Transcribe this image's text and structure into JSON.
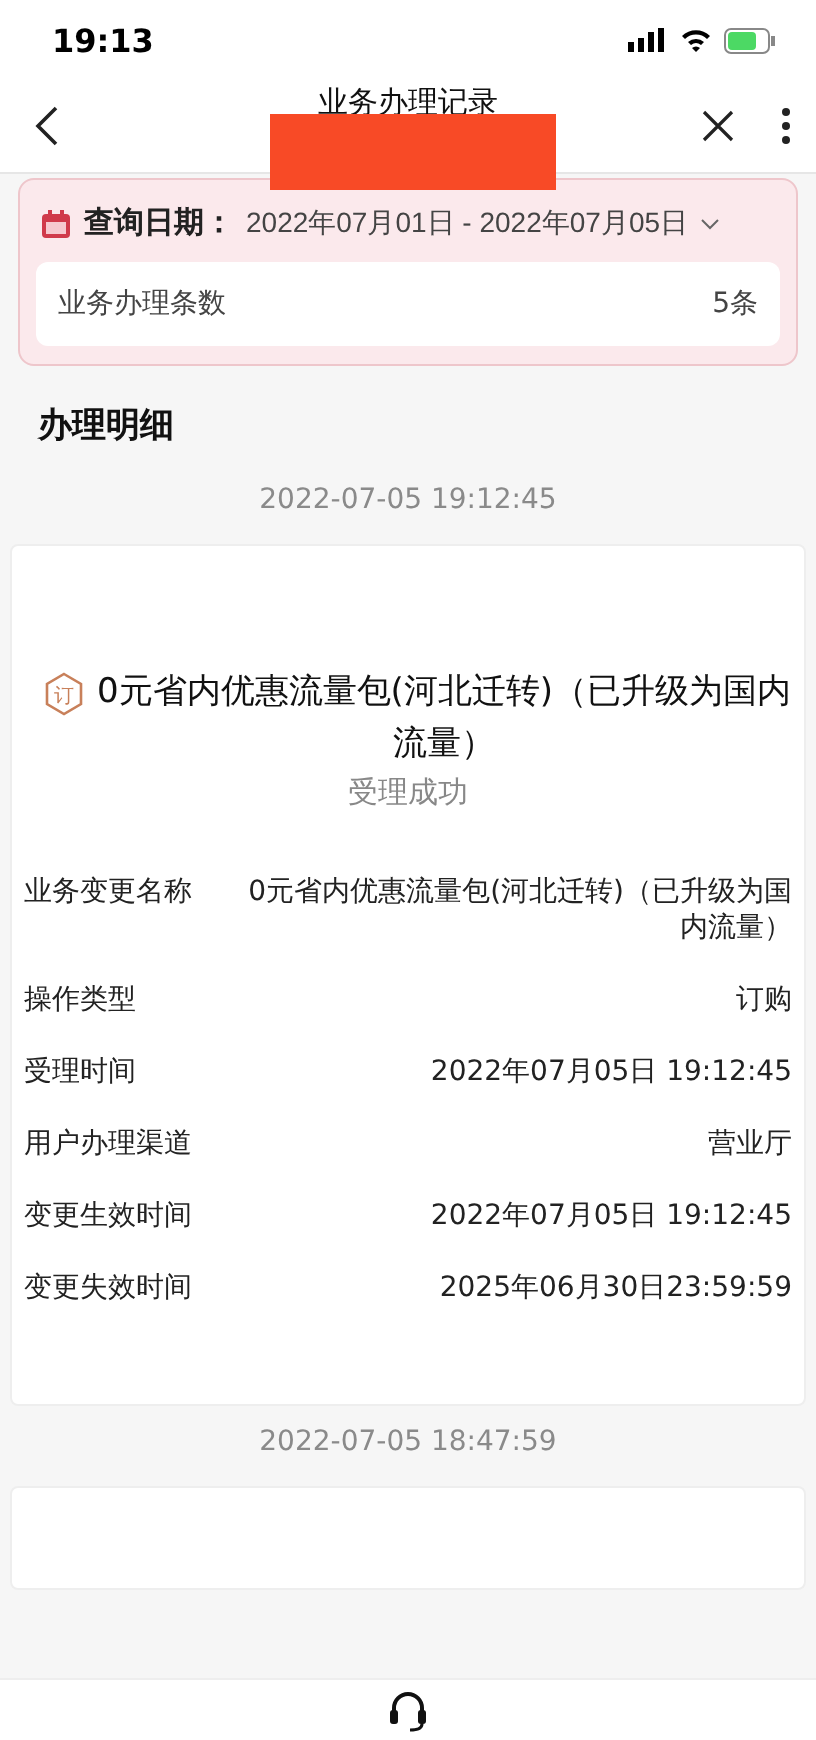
{
  "status_bar": {
    "time": "19:13"
  },
  "nav": {
    "title": "业务办理记录"
  },
  "filter": {
    "label": "查询日期：",
    "range": "2022年07月01日 - 2022年07月05日",
    "count_label": "业务办理条数",
    "count": "5条"
  },
  "section_title": "办理明细",
  "records": [
    {
      "timestamp": "2022-07-05 19:12:45",
      "badge": "订",
      "title": "0元省内优惠流量包(河北迁转)（已升级为国内流量）",
      "status": "受理成功",
      "fields": [
        {
          "label": "业务变更名称",
          "value": "0元省内优惠流量包(河北迁转)（已升级为国内流量）"
        },
        {
          "label": "操作类型",
          "value": "订购"
        },
        {
          "label": "受理时间",
          "value": "2022年07月05日 19:12:45"
        },
        {
          "label": "用户办理渠道",
          "value": "营业厅"
        },
        {
          "label": "变更生效时间",
          "value": "2022年07月05日 19:12:45"
        },
        {
          "label": "变更失效时间",
          "value": "2025年06月30日23:59:59"
        }
      ]
    },
    {
      "timestamp": "2022-07-05 18:47:59"
    }
  ]
}
